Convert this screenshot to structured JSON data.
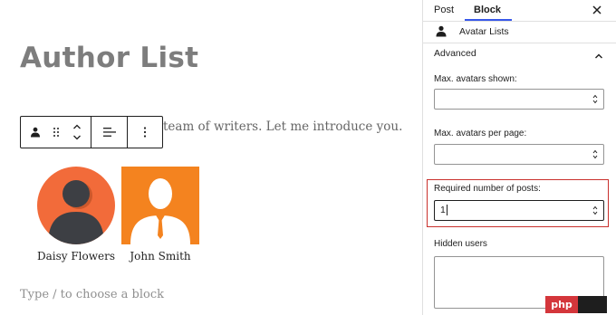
{
  "editor": {
    "title": "Author List",
    "intro_text": "team of writers. Let me introduce you.",
    "authors": [
      {
        "name": "Daisy Flowers"
      },
      {
        "name": "John Smith"
      }
    ],
    "appender_placeholder": "Type / to choose a block"
  },
  "toolbar": {
    "icons": [
      "avatar-block-icon",
      "drag-handle-icon",
      "move-up-icon",
      "move-down-icon",
      "align-icon",
      "more-options-icon"
    ]
  },
  "sidebar": {
    "tabs": [
      {
        "label": "Post"
      },
      {
        "label": "Block"
      }
    ],
    "active_tab": "Block",
    "block_name": "Avatar Lists",
    "panel_title": "Advanced",
    "fields": {
      "max_avatars_label": "Max. avatars shown:",
      "max_avatars_value": "",
      "per_page_label": "Max. avatars per page:",
      "per_page_value": "",
      "required_posts_label": "Required number of posts:",
      "required_posts_value": "1",
      "hidden_users_label": "Hidden users"
    }
  },
  "watermark": {
    "text": "php"
  },
  "colors": {
    "accent": "#3858e9",
    "highlight": "#c9302c",
    "avatar_orange": "#f26b3a",
    "avatar_orange_square": "#f4831f"
  }
}
